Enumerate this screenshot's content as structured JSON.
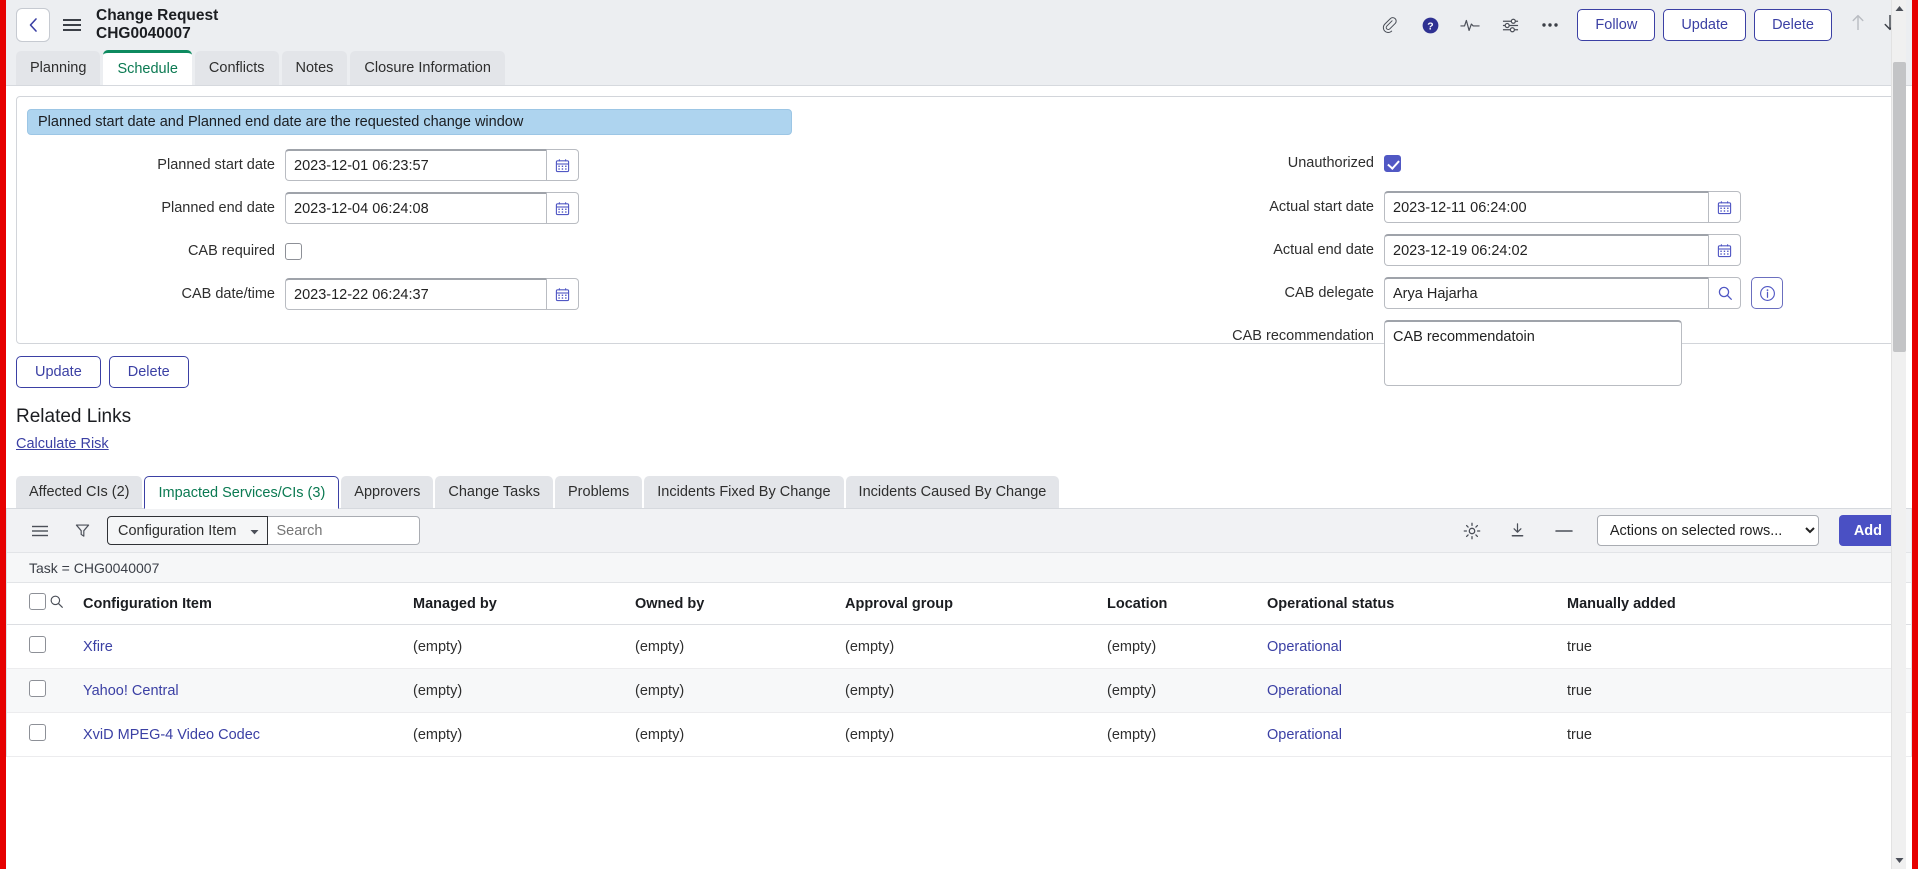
{
  "header": {
    "title_line1": "Change Request",
    "title_line2": "CHG0040007",
    "back_icon": "chevron-left-icon",
    "menu_icon": "hamburger-icon",
    "icons": [
      {
        "name": "attachment-icon",
        "label": "Attachments"
      },
      {
        "name": "help-icon",
        "label": "Help"
      },
      {
        "name": "activity-icon",
        "label": "Activity"
      },
      {
        "name": "personalize-icon",
        "label": "Personalize form"
      },
      {
        "name": "more-icon",
        "label": "More options"
      }
    ],
    "buttons": [
      {
        "label": "Follow"
      },
      {
        "label": "Update"
      },
      {
        "label": "Delete"
      }
    ],
    "prev_arrow": "arrow-up-icon",
    "next_arrow": "arrow-down-icon"
  },
  "tabs": [
    {
      "label": "Planning",
      "active": false
    },
    {
      "label": "Schedule",
      "active": true
    },
    {
      "label": "Conflicts",
      "active": false
    },
    {
      "label": "Notes",
      "active": false
    },
    {
      "label": "Closure Information",
      "active": false
    }
  ],
  "form": {
    "annotation": "Planned start date and Planned end date are the requested change window",
    "left": {
      "planned_start_date": {
        "label": "Planned start date",
        "value": "2023-12-01 06:23:57"
      },
      "planned_end_date": {
        "label": "Planned end date",
        "value": "2023-12-04 06:24:08"
      },
      "cab_required": {
        "label": "CAB required",
        "checked": false
      },
      "cab_date_time": {
        "label": "CAB date/time",
        "value": "2023-12-22 06:24:37"
      }
    },
    "right": {
      "unauthorized": {
        "label": "Unauthorized",
        "checked": true
      },
      "actual_start_date": {
        "label": "Actual start date",
        "value": "2023-12-11 06:24:00"
      },
      "actual_end_date": {
        "label": "Actual end date",
        "value": "2023-12-19 06:24:02"
      },
      "cab_delegate": {
        "label": "CAB delegate",
        "value": "Arya Hajarha"
      },
      "cab_recommendation": {
        "label": "CAB recommendation",
        "value": "CAB recommendatoin"
      }
    }
  },
  "form_actions": [
    {
      "label": "Update"
    },
    {
      "label": "Delete"
    }
  ],
  "related_links": {
    "title": "Related Links",
    "links": [
      {
        "label": "Calculate Risk"
      }
    ]
  },
  "related_tabs": [
    {
      "label": "Affected CIs (2)",
      "active": false
    },
    {
      "label": "Impacted Services/CIs (3)",
      "active": true
    },
    {
      "label": "Approvers",
      "active": false
    },
    {
      "label": "Change Tasks",
      "active": false
    },
    {
      "label": "Problems",
      "active": false
    },
    {
      "label": "Incidents Fixed By Change",
      "active": false
    },
    {
      "label": "Incidents Caused By Change",
      "active": false
    }
  ],
  "list_toolbar": {
    "menu_icon": "list-menu-icon",
    "filter_icon": "funnel-icon",
    "field_selector": "Configuration Item",
    "search_placeholder": "Search",
    "search_value": "",
    "settings_icon": "gear-icon",
    "export_icon": "download-icon",
    "collapse_icon": "minus-icon",
    "actions_select": "Actions on selected rows...",
    "add_button": "Add"
  },
  "list_breadcrumb": "Task = CHG0040007",
  "list": {
    "columns": [
      "Configuration Item",
      "Managed by",
      "Owned by",
      "Approval group",
      "Location",
      "Operational status",
      "Manually added"
    ],
    "rows": [
      {
        "configuration_item": "Xfire",
        "managed_by": "(empty)",
        "owned_by": "(empty)",
        "approval_group": "(empty)",
        "location": "(empty)",
        "operational_status": "Operational",
        "manually_added": "true"
      },
      {
        "configuration_item": "Yahoo! Central",
        "managed_by": "(empty)",
        "owned_by": "(empty)",
        "approval_group": "(empty)",
        "location": "(empty)",
        "operational_status": "Operational",
        "manually_added": "true"
      },
      {
        "configuration_item": "XviD MPEG-4 Video Codec",
        "managed_by": "(empty)",
        "owned_by": "(empty)",
        "approval_group": "(empty)",
        "location": "(empty)",
        "operational_status": "Operational",
        "manually_added": "true"
      }
    ]
  },
  "colors": {
    "accent": "#3b40a4",
    "add_button": "#4a50c4",
    "active_tab_text": "#0b7a52",
    "active_tab_border": "#0d8a5f",
    "annotation_bg": "#aed4ef",
    "checkbox_checked": "#5158c4",
    "page_border": "#e60000"
  }
}
